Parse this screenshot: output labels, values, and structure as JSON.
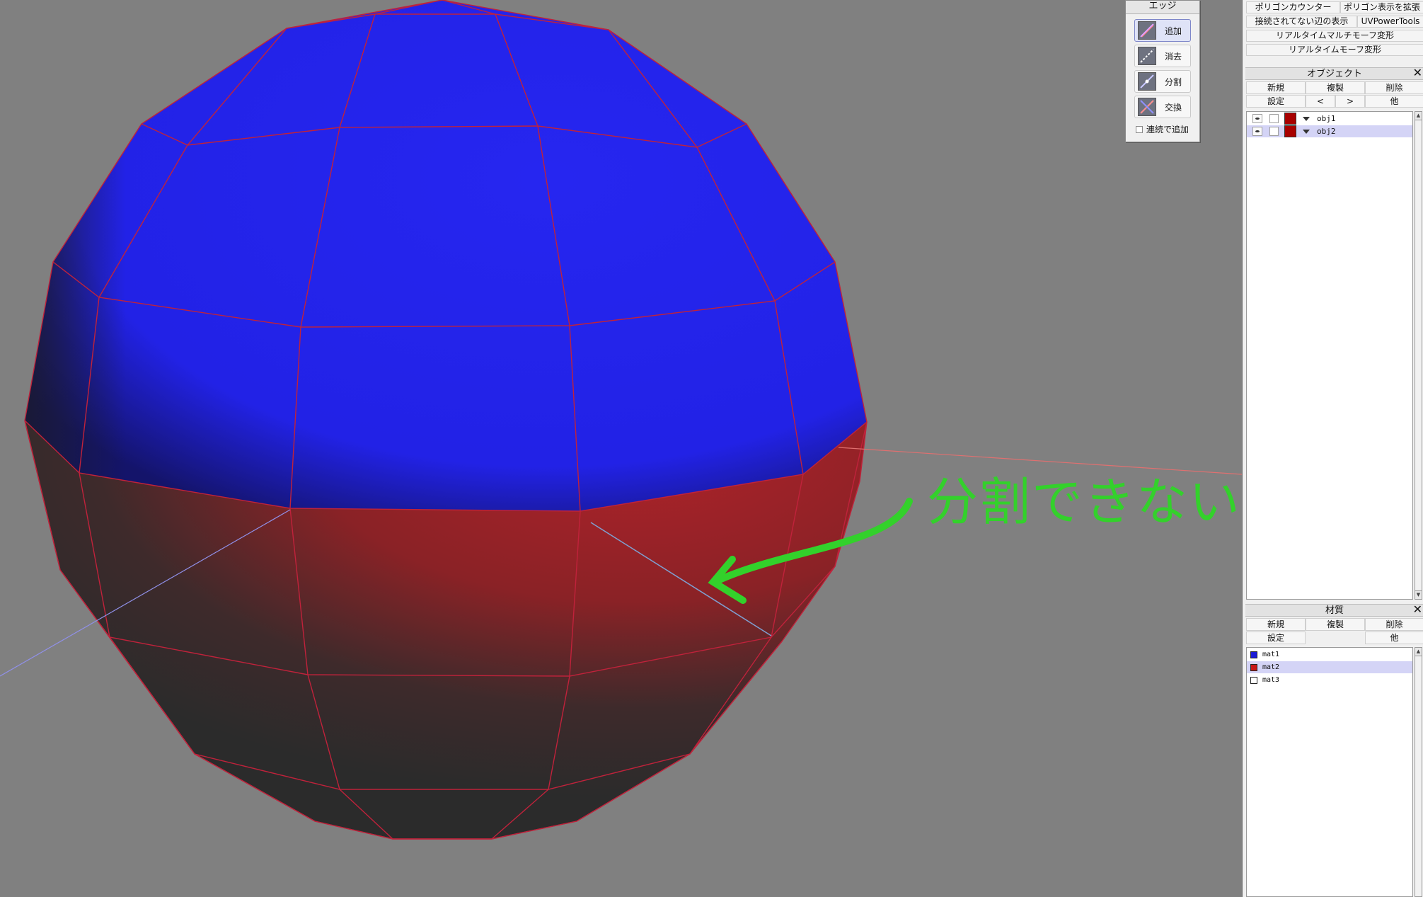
{
  "viewport": {
    "annotation_label": "分割できない",
    "colors": {
      "background": "#808080",
      "blue_material": "#2424ee",
      "red_material": "#a8242a",
      "edge": "#c0223b",
      "annotation": "#33d12b"
    }
  },
  "edge_palette": {
    "title": "エッジ",
    "tools": [
      {
        "label": "追加",
        "icon": "edge-add-icon",
        "active": true
      },
      {
        "label": "消去",
        "icon": "edge-delete-icon",
        "active": false
      },
      {
        "label": "分割",
        "icon": "edge-split-icon",
        "active": false
      },
      {
        "label": "交換",
        "icon": "edge-swap-icon",
        "active": false
      }
    ],
    "continuous_add_label": "連続で追加"
  },
  "plugins": {
    "polygon_counter": "ポリゴンカウンター",
    "polygon_view_expand": "ポリゴン表示を拡張",
    "unconnected_edges": "接続されてない辺の表示",
    "uv_power_tools": "UVPowerTools",
    "realtime_multi_morph": "リアルタイムマルチモーフ変形",
    "realtime_morph": "リアルタイムモーフ変形"
  },
  "object_panel": {
    "title": "オブジェクト",
    "close": "✕",
    "buttons": {
      "new": "新規",
      "duplicate": "複製",
      "delete": "削除",
      "settings": "設定",
      "prev": "<",
      "next": ">",
      "other": "他"
    },
    "objects": [
      {
        "name": "obj1",
        "color": "#a80000",
        "selected": false
      },
      {
        "name": "obj2",
        "color": "#a80000",
        "selected": true
      }
    ]
  },
  "material_panel": {
    "title": "材質",
    "close": "✕",
    "buttons": {
      "new": "新規",
      "duplicate": "複製",
      "delete": "削除",
      "settings": "設定",
      "other": "他"
    },
    "materials": [
      {
        "name": "mat1",
        "color": "#1a1ad6",
        "selected": false
      },
      {
        "name": "mat2",
        "color": "#c81818",
        "selected": true
      },
      {
        "name": "mat3",
        "color": "#ffffff",
        "selected": false
      }
    ]
  }
}
